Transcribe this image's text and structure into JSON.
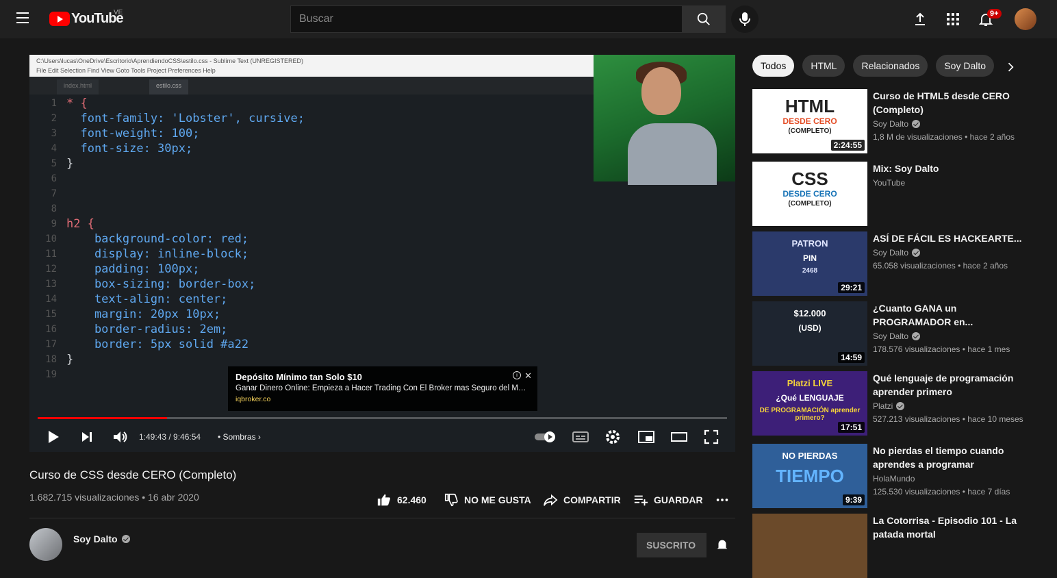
{
  "header": {
    "logo_text": "YouTube",
    "country": "VE",
    "search_placeholder": "Buscar",
    "notifications_count": "9+"
  },
  "player": {
    "editor_path": "C:\\Users\\lucas\\OneDrive\\Escritorio\\AprendiendoCSS\\estilo.css - Sublime Text (UNREGISTERED)",
    "editor_menu": "File   Edit   Selection   Find   View   Goto   Tools   Project   Preferences   Help",
    "tabs": [
      "estilo.css",
      "index.html"
    ],
    "code_lines": [
      {
        "n": "1",
        "text": "* {"
      },
      {
        "n": "2",
        "text": "  font-family: 'Lobster', cursive;"
      },
      {
        "n": "3",
        "text": "  font-weight: 100;"
      },
      {
        "n": "4",
        "text": "  font-size: 30px;"
      },
      {
        "n": "5",
        "text": "}"
      },
      {
        "n": "6",
        "text": ""
      },
      {
        "n": "7",
        "text": ""
      },
      {
        "n": "8",
        "text": ""
      },
      {
        "n": "9",
        "text": "h2 {"
      },
      {
        "n": "10",
        "text": "    background-color: red;"
      },
      {
        "n": "11",
        "text": "    display: inline-block;"
      },
      {
        "n": "12",
        "text": "    padding: 100px;"
      },
      {
        "n": "13",
        "text": "    box-sizing: border-box;"
      },
      {
        "n": "14",
        "text": "    text-align: center;"
      },
      {
        "n": "15",
        "text": "    margin: 20px 10px;"
      },
      {
        "n": "16",
        "text": "    border-radius: 2em;"
      },
      {
        "n": "17",
        "text": "    border: 5px solid #a22"
      },
      {
        "n": "18",
        "text": "}"
      },
      {
        "n": "19",
        "text": ""
      }
    ],
    "ad": {
      "title": "Depósito Mínimo tan Solo $10",
      "body": "Ganar Dinero Online: Empieza a Hacer Trading Con El Broker mas Seguro del Mundo.",
      "url": "iqbroker.co"
    },
    "progress_fraction": 0.188,
    "time": "1:49:43 / 9:46:54",
    "chapter": "Sombras"
  },
  "video": {
    "title": "Curso de CSS desde CERO (Completo)",
    "views": "1.682.715 visualizaciones • 16 abr 2020",
    "likes": "62.460",
    "dislike_label": "NO ME GUSTA",
    "share_label": "COMPARTIR",
    "save_label": "GUARDAR"
  },
  "channel": {
    "name": "Soy Dalto",
    "subscribe_label": "SUSCRITO"
  },
  "chips": [
    "Todos",
    "HTML",
    "Relacionados",
    "Soy Dalto"
  ],
  "recommendations": [
    {
      "title": "Curso de HTML5 desde CERO (Completo)",
      "channel": "Soy Dalto",
      "verified": true,
      "meta": "1,8 M de visualizaciones • hace 2 años",
      "duration": "2:24:55",
      "thumb_line1": "HTML",
      "thumb_line2": "DESDE CERO",
      "thumb_line3": "(COMPLETO)"
    },
    {
      "title": "Mix: Soy Dalto",
      "channel": "YouTube",
      "verified": false,
      "meta": "",
      "duration": "",
      "thumb_line1": "CSS",
      "thumb_line2": "DESDE CERO",
      "thumb_line3": "(COMPLETO)"
    },
    {
      "title": "ASÍ DE FÁCIL ES HACKEARTE...",
      "channel": "Soy Dalto",
      "verified": true,
      "meta": "65.058 visualizaciones • hace 2 años",
      "duration": "29:21",
      "thumb_line1": "PATRON",
      "thumb_line2": "PIN",
      "thumb_line3": "2468"
    },
    {
      "title": "¿Cuanto GANA un PROGRAMADOR en...",
      "channel": "Soy Dalto",
      "verified": true,
      "meta": "178.576 visualizaciones • hace 1 mes",
      "duration": "14:59",
      "thumb_line1": "$12.000",
      "thumb_line2": "(USD)",
      "thumb_line3": ""
    },
    {
      "title": "Qué lenguaje de programación aprender primero",
      "channel": "Platzi",
      "verified": true,
      "meta": "527.213 visualizaciones • hace 10 meses",
      "duration": "17:51",
      "thumb_line1": "Platzi LIVE",
      "thumb_line2": "¿Qué LENGUAJE",
      "thumb_line3": "DE PROGRAMACIÓN aprender primero?"
    },
    {
      "title": "No pierdas el tiempo cuando aprendes a programar",
      "channel": "HolaMundo",
      "verified": false,
      "meta": "125.530 visualizaciones • hace 7 días",
      "duration": "9:39",
      "thumb_line1": "NO PIERDAS",
      "thumb_line2": "TIEMPO",
      "thumb_line3": ""
    },
    {
      "title": "La Cotorrisa - Episodio 101 - La patada mortal",
      "channel": "",
      "verified": false,
      "meta": "",
      "duration": "",
      "thumb_line1": "",
      "thumb_line2": "",
      "thumb_line3": ""
    }
  ]
}
